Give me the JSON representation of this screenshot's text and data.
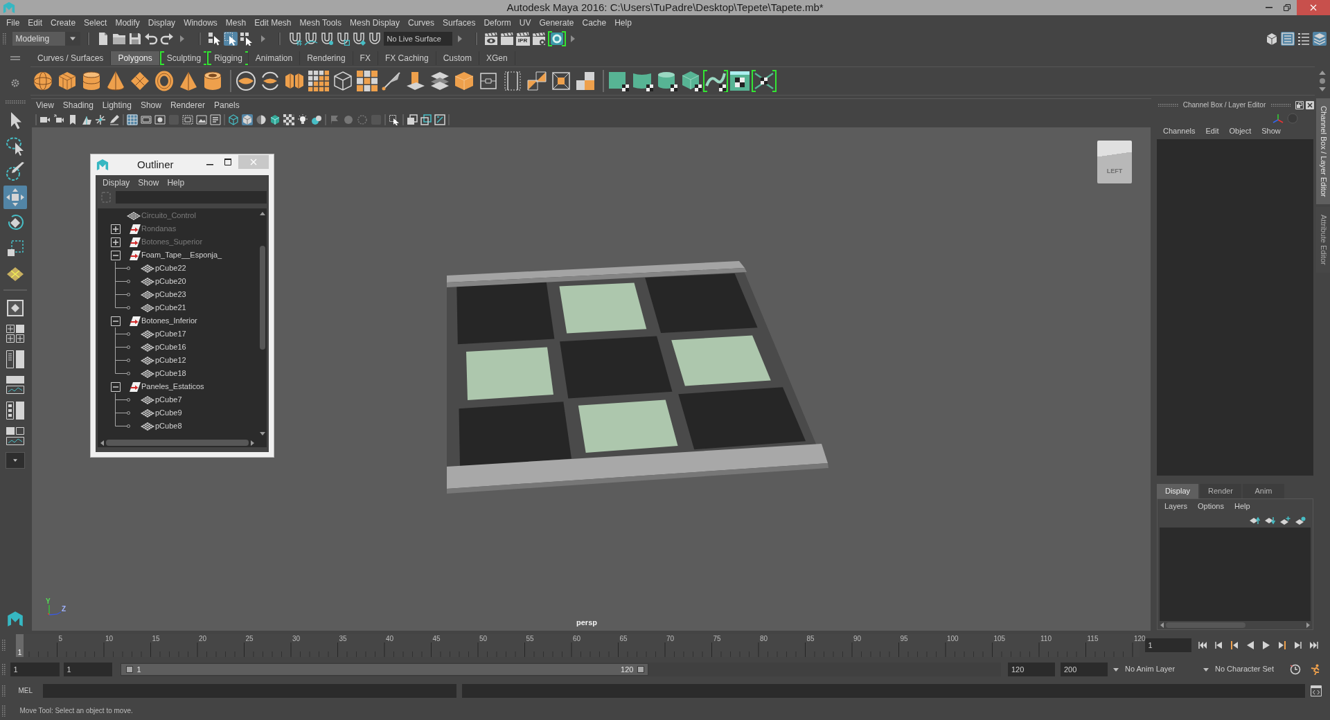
{
  "window": {
    "title": "Autodesk Maya 2016: C:\\Users\\TuPadre\\Desktop\\Tepete\\Tapete.mb*"
  },
  "menu_bar": [
    "File",
    "Edit",
    "Create",
    "Select",
    "Modify",
    "Display",
    "Windows",
    "Mesh",
    "Edit Mesh",
    "Mesh Tools",
    "Mesh Display",
    "Curves",
    "Surfaces",
    "Deform",
    "UV",
    "Generate",
    "Cache",
    "Help"
  ],
  "status_line": {
    "workspace": "Modeling",
    "selection_modes": [
      {
        "on": false
      },
      {
        "on": true
      },
      {
        "on": false
      }
    ],
    "live_surface": "No Live Surface",
    "render_tools": [
      {
        "highlighted": false
      },
      {
        "highlighted": false
      },
      {
        "highlighted": false,
        "label": "IPR"
      },
      {
        "highlighted": false
      },
      {
        "highlighted": true
      }
    ],
    "panel_toggles": [
      {
        "on": false
      },
      {
        "on": true
      },
      {
        "on": false
      },
      {
        "on": true
      }
    ]
  },
  "shelf": {
    "tabs": [
      {
        "label": "Curves / Surfaces",
        "selected": false,
        "highlighted": false
      },
      {
        "label": "Polygons",
        "selected": true,
        "highlighted": false
      },
      {
        "label": "Sculpting",
        "selected": false,
        "highlighted": true
      },
      {
        "label": "Rigging",
        "selected": false,
        "highlighted": true
      },
      {
        "label": "Animation",
        "selected": false,
        "highlighted": false
      },
      {
        "label": "Rendering",
        "selected": false,
        "highlighted": false
      },
      {
        "label": "FX",
        "selected": false,
        "highlighted": false
      },
      {
        "label": "FX Caching",
        "selected": false,
        "highlighted": false
      },
      {
        "label": "Custom",
        "selected": false,
        "highlighted": false
      },
      {
        "label": "XGen",
        "selected": false,
        "highlighted": false
      }
    ],
    "icons": [
      {
        "highlighted": false
      },
      {
        "highlighted": false
      },
      {
        "highlighted": false
      },
      {
        "highlighted": false
      },
      {
        "highlighted": false
      },
      {
        "highlighted": false
      },
      {
        "highlighted": false
      },
      {
        "highlighted": false
      },
      {
        "highlighted": false
      },
      {
        "highlighted": false
      },
      {
        "highlighted": false
      },
      {
        "highlighted": false
      },
      {
        "highlighted": false
      },
      {
        "highlighted": false
      },
      {
        "highlighted": false
      },
      {
        "highlighted": false
      },
      {
        "highlighted": false
      },
      {
        "highlighted": false
      },
      {
        "highlighted": false
      },
      {
        "highlighted": false
      },
      {
        "highlighted": false
      },
      {
        "highlighted": false
      },
      {
        "highlighted": false
      },
      {
        "highlighted": false
      },
      {
        "highlighted": false
      },
      {
        "highlighted": false
      },
      {
        "highlighted": false
      },
      {
        "highlighted": true
      },
      {
        "highlighted": false
      },
      {
        "highlighted": true
      }
    ]
  },
  "toolbox": {
    "tools": [
      {
        "selected": false
      },
      {
        "selected": false
      },
      {
        "selected": false
      },
      {
        "selected": true
      },
      {
        "selected": false
      },
      {
        "selected": false
      },
      {
        "selected": false
      }
    ]
  },
  "viewport": {
    "menus": [
      "View",
      "Shading",
      "Lighting",
      "Show",
      "Renderer",
      "Panels"
    ],
    "toolbar": [
      {
        "on": false,
        "disabled": false
      },
      {
        "on": false,
        "disabled": false
      },
      {
        "on": false,
        "disabled": false
      },
      {
        "on": false,
        "disabled": false
      },
      {
        "on": false,
        "disabled": false
      },
      {
        "on": false,
        "disabled": false
      },
      {
        "on": true,
        "disabled": false
      },
      {
        "on": false,
        "disabled": false
      },
      {
        "on": false,
        "disabled": false
      },
      {
        "on": false,
        "disabled": false
      },
      {
        "on": false,
        "disabled": false
      },
      {
        "on": false,
        "disabled": false
      },
      {
        "on": false,
        "disabled": false
      },
      {
        "on": false,
        "disabled": false
      },
      {
        "on": true,
        "disabled": false
      },
      {
        "on": false,
        "disabled": false
      },
      {
        "on": false,
        "disabled": false
      },
      {
        "on": false,
        "disabled": false
      },
      {
        "on": false,
        "disabled": false
      },
      {
        "on": false,
        "disabled": false
      },
      {
        "on": false,
        "disabled": true
      },
      {
        "on": false,
        "disabled": true
      },
      {
        "on": false,
        "disabled": true
      },
      {
        "on": false,
        "disabled": false
      },
      {
        "on": false,
        "disabled": false
      },
      {
        "on": false,
        "disabled": false
      },
      {
        "on": false,
        "disabled": false
      },
      {
        "on": false,
        "disabled": false
      }
    ],
    "view_cube_label": "LEFT",
    "camera_label": "persp",
    "axis_labels": [
      {
        "label": "Y",
        "color": "#55dd55"
      },
      {
        "label": "Z",
        "color": "#9fb2ff"
      }
    ]
  },
  "outliner": {
    "title": "Outliner",
    "menus": [
      "Display",
      "Show",
      "Help"
    ],
    "items": [
      {
        "label": "Circuito_Control",
        "kind": "mesh",
        "hidden": true
      },
      {
        "label": "Rondanas",
        "kind": "group",
        "hidden": true,
        "expanded": false
      },
      {
        "label": "Botones_Superior",
        "kind": "group",
        "hidden": true,
        "expanded": false
      },
      {
        "label": "Foam_Tape__Esponja_",
        "kind": "group",
        "hidden": false,
        "expanded": true,
        "children": [
          {
            "label": "pCube22",
            "kind": "mesh",
            "hidden": false
          },
          {
            "label": "pCube20",
            "kind": "mesh",
            "hidden": false
          },
          {
            "label": "pCube23",
            "kind": "mesh",
            "hidden": false
          },
          {
            "label": "pCube21",
            "kind": "mesh",
            "hidden": false
          }
        ]
      },
      {
        "label": "Botones_Inferior",
        "kind": "group",
        "hidden": false,
        "expanded": true,
        "children": [
          {
            "label": "pCube17",
            "kind": "mesh",
            "hidden": false
          },
          {
            "label": "pCube16",
            "kind": "mesh",
            "hidden": false
          },
          {
            "label": "pCube12",
            "kind": "mesh",
            "hidden": false
          },
          {
            "label": "pCube18",
            "kind": "mesh",
            "hidden": false
          }
        ]
      },
      {
        "label": "Paneles_Estaticos",
        "kind": "group",
        "hidden": false,
        "expanded": true,
        "children": [
          {
            "label": "pCube7",
            "kind": "mesh",
            "hidden": false
          },
          {
            "label": "pCube9",
            "kind": "mesh",
            "hidden": false
          },
          {
            "label": "pCube8",
            "kind": "mesh",
            "hidden": false
          }
        ]
      }
    ]
  },
  "channel_box": {
    "title": "Channel Box / Layer Editor",
    "menus": [
      "Channels",
      "Edit",
      "Object",
      "Show"
    ],
    "layer_tabs": [
      {
        "label": "Display",
        "selected": true
      },
      {
        "label": "Render",
        "selected": false
      },
      {
        "label": "Anim",
        "selected": false
      }
    ],
    "layer_menus": [
      "Layers",
      "Options",
      "Help"
    ]
  },
  "side_tabs": [
    {
      "label": "Channel Box / Layer Editor",
      "selected": true
    },
    {
      "label": "Attribute Editor",
      "selected": false
    }
  ],
  "timeline": {
    "level": 0,
    "current_frame": "1",
    "labels": [
      "5",
      "10",
      "15",
      "20",
      "25",
      "30",
      "35",
      "40",
      "45",
      "50",
      "55",
      "60",
      "65",
      "70",
      "75",
      "80",
      "85",
      "90",
      "95",
      "100",
      "105",
      "110",
      "115",
      "120"
    ],
    "frame_field": "1"
  },
  "range_slider": {
    "start_field": "1",
    "playback_start_field": "1",
    "level": 0.6,
    "range_start_label": "1",
    "range_end_label": "120",
    "playback_end_field": "120",
    "end_field": "200",
    "anim_layer": "No Anim Layer",
    "character_set": "No Character Set"
  },
  "command_line": {
    "language": "MEL"
  },
  "help_line": "Move Tool: Select an object to move."
}
